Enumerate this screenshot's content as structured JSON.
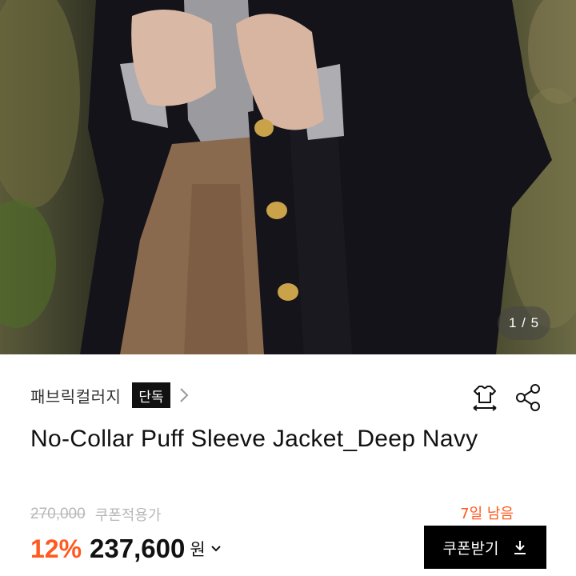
{
  "gallery": {
    "counter": "1 / 5"
  },
  "brand": {
    "name": "패브릭컬러지",
    "badge": "단독"
  },
  "product": {
    "title": "No-Collar Puff Sleeve Jacket_Deep Navy"
  },
  "price": {
    "original": "270,000",
    "coupon_note": "쿠폰적용가",
    "discount": "12%",
    "sale": "237,600",
    "currency": "원"
  },
  "coupon": {
    "days_left": "7일 남음",
    "button_label": "쿠폰받기"
  },
  "colors": {
    "accent": "#ff5a1f",
    "badge_bg": "#111111",
    "button_bg": "#000000",
    "muted": "#b7b7b7"
  },
  "icons": [
    "fit-guide-icon",
    "share-icon",
    "chevron-right-icon",
    "chevron-down-icon",
    "download-icon"
  ]
}
